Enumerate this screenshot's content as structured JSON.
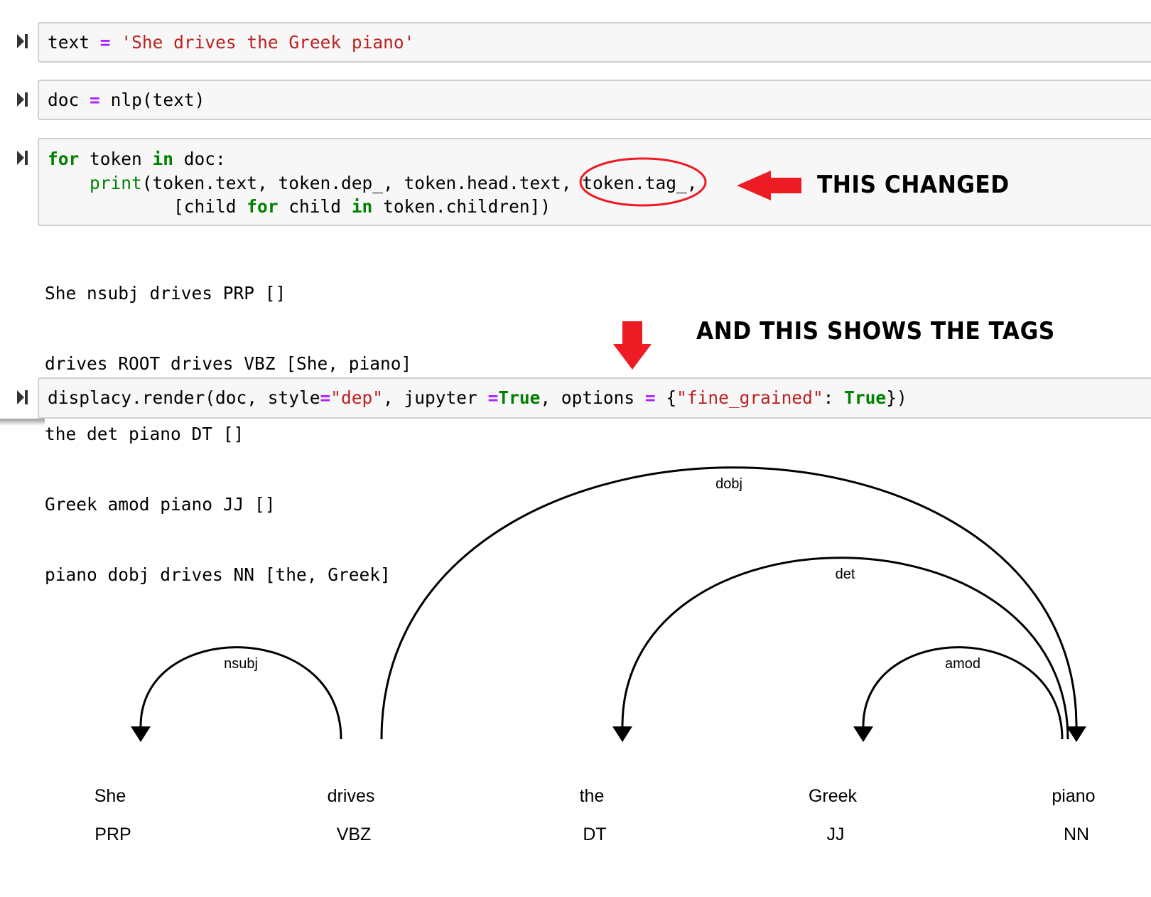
{
  "cells": [
    {
      "tokens": [
        [
          "text",
          ""
        ],
        [
          " ",
          ""
        ],
        [
          "=",
          "op"
        ],
        [
          " ",
          ""
        ],
        [
          "'She drives the Greek piano'",
          "str"
        ]
      ]
    },
    {
      "tokens": [
        [
          "doc",
          ""
        ],
        [
          " ",
          ""
        ],
        [
          "=",
          "op"
        ],
        [
          " ",
          ""
        ],
        [
          "nlp(text)",
          ""
        ]
      ]
    },
    {
      "lines": [
        [
          [
            "for",
            "kw"
          ],
          [
            " token ",
            ""
          ],
          [
            "in",
            "kw"
          ],
          [
            " doc:",
            ""
          ]
        ],
        [
          [
            "    ",
            ""
          ],
          [
            "print",
            "bi"
          ],
          [
            "(token.text, token.dep_, token.head.text, token.tag_,",
            ""
          ]
        ],
        [
          [
            "            [child ",
            ""
          ],
          [
            "for",
            "kw"
          ],
          [
            " child ",
            ""
          ],
          [
            "in",
            "kw"
          ],
          [
            " token.children])",
            ""
          ]
        ]
      ]
    },
    {
      "tokens": [
        [
          "displacy.render(doc, style",
          ""
        ],
        [
          "=",
          "op"
        ],
        [
          "\"dep\"",
          "str"
        ],
        [
          ", jupyter ",
          ""
        ],
        [
          "=",
          "op"
        ],
        [
          "True",
          "kw"
        ],
        [
          ", options ",
          ""
        ],
        [
          "=",
          "op"
        ],
        [
          " {",
          ""
        ],
        [
          "\"fine_grained\"",
          "str"
        ],
        [
          ": ",
          ""
        ],
        [
          "True",
          "kw"
        ],
        [
          "})",
          ""
        ]
      ]
    }
  ],
  "output_lines": [
    "She nsubj drives PRP []",
    "drives ROOT drives VBZ [She, piano]",
    "the det piano DT []",
    "Greek amod piano JJ []",
    "piano dobj drives NN [the, Greek]"
  ],
  "annotations": {
    "changed": "THIS CHANGED",
    "shows_tags": "AND THIS SHOWS THE TAGS",
    "accent": "#ed1c24"
  },
  "dep": {
    "words": [
      {
        "text": "She",
        "tag": "PRP"
      },
      {
        "text": "drives",
        "tag": "VBZ"
      },
      {
        "text": "the",
        "tag": "DT"
      },
      {
        "text": "Greek",
        "tag": "JJ"
      },
      {
        "text": "piano",
        "tag": "NN"
      }
    ],
    "arcs": [
      {
        "label": "nsubj",
        "head": 1,
        "dep": 0
      },
      {
        "label": "dobj",
        "head": 1,
        "dep": 4
      },
      {
        "label": "det",
        "head": 4,
        "dep": 2
      },
      {
        "label": "amod",
        "head": 4,
        "dep": 3
      }
    ]
  }
}
